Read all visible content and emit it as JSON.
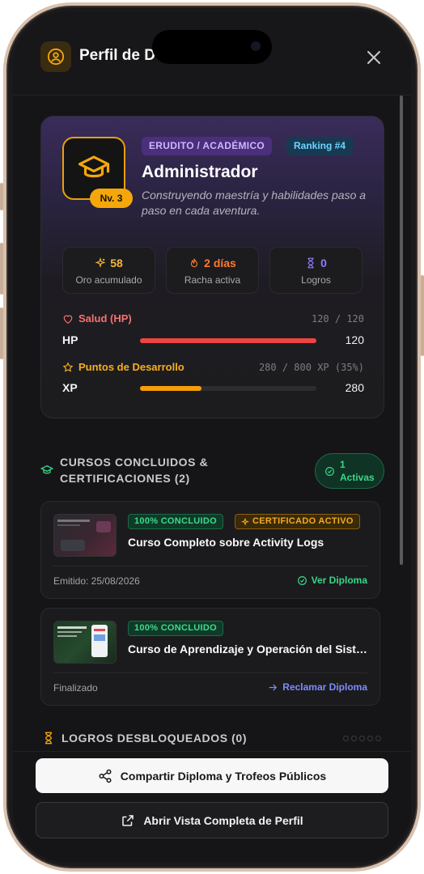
{
  "header": {
    "title": "Perfil de Do"
  },
  "profile": {
    "role_tag": "ERUDITO / ACADÉMICO",
    "rank_tag": "Ranking #4",
    "level": "Nv. 3",
    "name": "Administrador",
    "description": "Construyendo maestría y habilidades paso a paso en cada aventura."
  },
  "stats": [
    {
      "value": "58",
      "label": "Oro acumulado",
      "color": "#f5b63a",
      "icon": "sparkles-icon"
    },
    {
      "value": "2 días",
      "label": "Racha activa",
      "color": "#ff7a2e",
      "icon": "flame-icon"
    },
    {
      "value": "0",
      "label": "Logros",
      "color": "#8f7bff",
      "icon": "hourglass-icon"
    }
  ],
  "bars": {
    "hp": {
      "title": "Salud (HP)",
      "range": "120 / 120",
      "key": "HP",
      "value": "120",
      "fraction": 1.0,
      "color": "#ef4444"
    },
    "xp": {
      "title": "Puntos de Desarrollo",
      "range": "280 / 800 XP (35%)",
      "key": "XP",
      "value": "280",
      "fraction": 0.35,
      "color": "#f59e0b"
    }
  },
  "courses_section": {
    "title_line1": "CURSOS CONCLUIDOS &",
    "title_line2": "CERTIFICACIONES (2)",
    "active_count": "1",
    "active_label": "Activas"
  },
  "courses": [
    {
      "badge_done": "100% CONCLUIDO",
      "badge_cert": "CERTIFICADO ACTIVO",
      "title": "Curso Completo sobre Activity Logs",
      "footer": "Emitido: 25/08/2026",
      "link": "Ver Diploma",
      "link_color": "#3ad68a"
    },
    {
      "badge_done": "100% CONCLUIDO",
      "title": "Curso de Aprendizaje y Operación del Sistema",
      "footer": "Finalizado",
      "link": "Reclamar Diploma",
      "link_color": "#7c8cff"
    }
  ],
  "achievements": {
    "title": "LOGROS DESBLOQUEADOS (0)"
  },
  "actions": {
    "share": "Compartir Diploma y Trofeos Públicos",
    "open_profile": "Abrir Vista Completa de Perfil"
  }
}
